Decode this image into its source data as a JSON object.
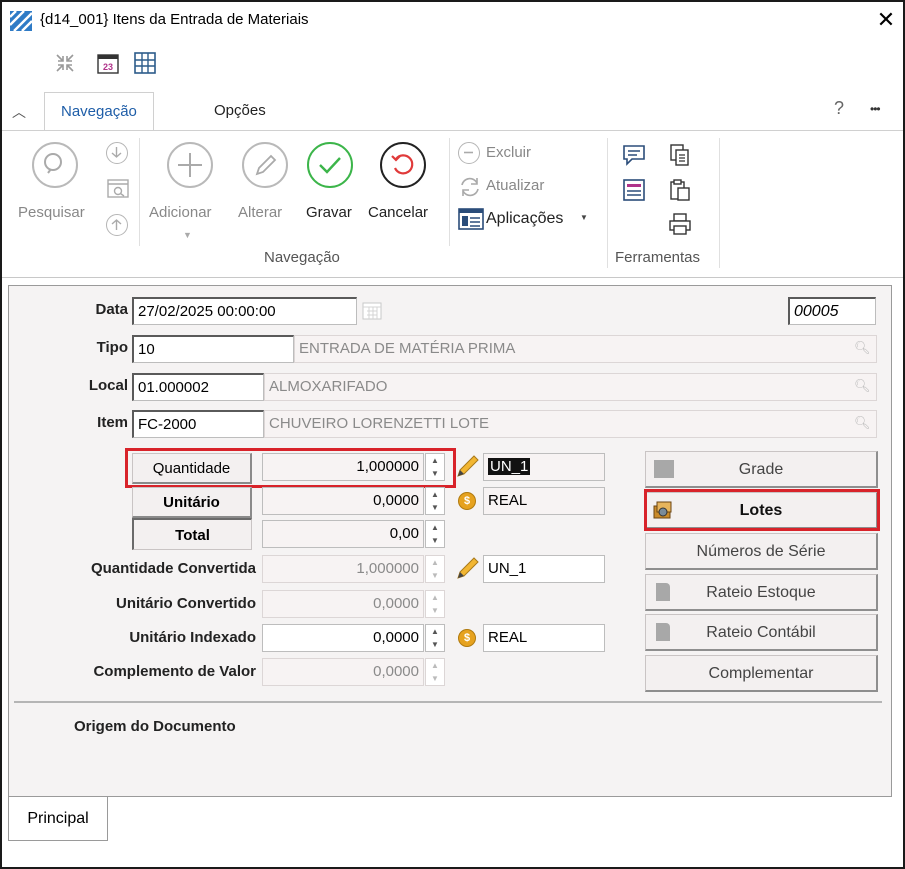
{
  "window": {
    "title": "{d14_001} Itens da Entrada de Materiais"
  },
  "ribbon": {
    "tabs": [
      {
        "label": "Navegação"
      },
      {
        "label": "Opções"
      }
    ],
    "help": "?",
    "more": "•••",
    "search_label": "Pesquisar",
    "add_label": "Adicionar",
    "edit_label": "Alterar",
    "save_label": "Gravar",
    "cancel_label": "Cancelar",
    "delete_label": "Excluir",
    "refresh_label": "Atualizar",
    "apps_label": "Aplicações",
    "group_navigation": "Navegação",
    "group_tools": "Ferramentas"
  },
  "form": {
    "date_label": "Data",
    "date_value": "27/02/2025 00:00:00",
    "doc_number": "00005",
    "type_label": "Tipo",
    "type_code": "10",
    "type_name": "ENTRADA DE MATÉRIA PRIMA",
    "local_label": "Local",
    "local_code": "01.000002",
    "local_name": "ALMOXARIFADO",
    "item_label": "Item",
    "item_code": "FC-2000",
    "item_name": "CHUVEIRO LORENZETTI LOTE",
    "quantity_label": "Quantidade",
    "quantity_value": "1,000000",
    "quantity_unit": "UN_1",
    "unit_price_label": "Unitário",
    "unit_price_value": "0,0000",
    "unit_price_currency": "REAL",
    "total_label": "Total",
    "total_value": "0,00",
    "conv_qty_label": "Quantidade Convertida",
    "conv_qty_value": "1,000000",
    "conv_qty_unit": "UN_1",
    "conv_unit_label": "Unitário Convertido",
    "conv_unit_value": "0,0000",
    "idx_unit_label": "Unitário Indexado",
    "idx_unit_value": "0,0000",
    "idx_unit_currency": "REAL",
    "compl_label": "Complemento de Valor",
    "compl_value": "0,0000",
    "origin_label": "Origem do Documento"
  },
  "side_buttons": {
    "grade": "Grade",
    "lotes": "Lotes",
    "serials": "Números de Série",
    "stock_alloc": "Rateio Estoque",
    "acct_alloc": "Rateio Contábil",
    "complement": "Complementar"
  },
  "bottom_tab": "Principal",
  "colors": {
    "highlight": "#d8232a",
    "accent_tab": "#1f5ea8",
    "save_green": "#3cb54a",
    "cancel_red": "#e03a3a"
  }
}
